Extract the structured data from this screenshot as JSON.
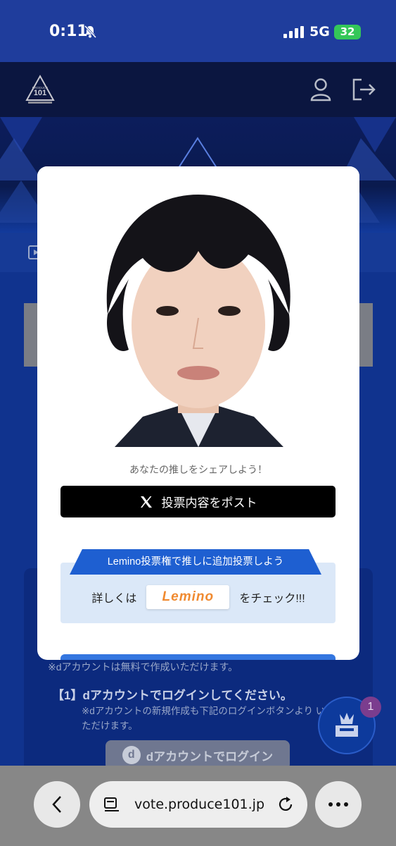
{
  "status_bar": {
    "time": "0:11",
    "network": "5G",
    "battery": "32"
  },
  "header": {
    "logo_text": "PRODUCE 101",
    "user_icon": "user-icon",
    "logout_icon": "logout-icon"
  },
  "page": {
    "note": "※dアカウントは無料で作成いただけます。",
    "step1": "【1】dアカウントでログインしてください。",
    "step1_note": "※dアカウントの新規作成も下記のログインボタンより いただけます。",
    "login_button": "dアカウントでログイン",
    "fab_badge": "1"
  },
  "modal": {
    "share_text": "あなたの推しをシェアしよう！",
    "post_button": "投票内容をポスト",
    "lemino_ribbon": "Lemino投票権で推しに追加投票しよう",
    "lemino_prefix": "詳しくは",
    "lemino_logo": "Lemino",
    "lemino_suffix": "をチェック!!!"
  },
  "browser": {
    "url": "vote.produce101.jp"
  },
  "colors": {
    "accent": "#1e5fd1",
    "header_bg": "#0b1640",
    "status_bg": "#1f3d9c",
    "lemino": "#f08a30"
  }
}
